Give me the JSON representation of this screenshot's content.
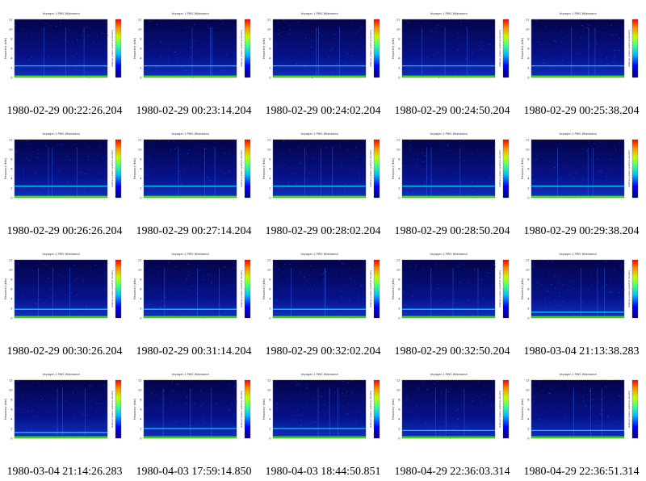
{
  "figure": {
    "panel_title": "Voyager-1 PWS Wideband",
    "ylabel": "Frequency (kHz)",
    "colorbar_label": "relative power spectral density",
    "yticks": [
      "0",
      "2",
      "4",
      "6",
      "8",
      "10",
      "12"
    ],
    "colors": {
      "background": "#00008b",
      "band": "#00c8ff",
      "low_band": "#39e600",
      "bright": "#ff3000"
    }
  },
  "captions": [
    "1980-02-29 00:22:26.204",
    "1980-02-29 00:23:14.204",
    "1980-02-29 00:24:02.204",
    "1980-02-29 00:24:50.204",
    "1980-02-29 00:25:38.204",
    "1980-02-29 00:26:26.204",
    "1980-02-29 00:27:14.204",
    "1980-02-29 00:28:02.204",
    "1980-02-29 00:28:50.204",
    "1980-02-29 00:29:38.204",
    "1980-02-29 00:30:26.204",
    "1980-02-29 00:31:14.204",
    "1980-02-29 00:32:02.204",
    "1980-02-29 00:32:50.204",
    "1980-03-04 21:13:38.283",
    "1980-03-04 21:14:26.283",
    "1980-04-03 17:59:14.850",
    "1980-04-03 18:44:50.851",
    "1980-04-29 22:36:03.314",
    "1980-04-29 22:36:51.314"
  ],
  "chart_data": {
    "type": "heatmap",
    "layout": "grid 4 rows x 5 columns of spectrogram panels",
    "ylabel": "Frequency (kHz)",
    "ylim": [
      0,
      12
    ],
    "colorbar": "relative power spectral density",
    "panels": [
      {
        "caption": "1980-02-29 00:22:26.204",
        "band_khz": 2.4,
        "low_band_khz": 0.4
      },
      {
        "caption": "1980-02-29 00:23:14.204",
        "band_khz": 2.4,
        "low_band_khz": 0.4
      },
      {
        "caption": "1980-02-29 00:24:02.204",
        "band_khz": 2.4,
        "low_band_khz": 0.4
      },
      {
        "caption": "1980-02-29 00:24:50.204",
        "band_khz": 2.4,
        "low_band_khz": 0.4
      },
      {
        "caption": "1980-02-29 00:25:38.204",
        "band_khz": 2.4,
        "low_band_khz": 0.4
      },
      {
        "caption": "1980-02-29 00:26:26.204",
        "band_khz": 2.4,
        "low_band_khz": 0.4
      },
      {
        "caption": "1980-02-29 00:27:14.204",
        "band_khz": 2.4,
        "low_band_khz": 0.4
      },
      {
        "caption": "1980-02-29 00:28:02.204",
        "band_khz": 2.4,
        "low_band_khz": 0.4
      },
      {
        "caption": "1980-02-29 00:28:50.204",
        "band_khz": 2.4,
        "low_band_khz": 0.4
      },
      {
        "caption": "1980-02-29 00:29:38.204",
        "band_khz": 2.4,
        "low_band_khz": 0.4
      },
      {
        "caption": "1980-02-29 00:30:26.204",
        "band_khz": 1.8,
        "low_band_khz": 0.4
      },
      {
        "caption": "1980-02-29 00:31:14.204",
        "band_khz": 1.8,
        "low_band_khz": 0.4
      },
      {
        "caption": "1980-02-29 00:32:02.204",
        "band_khz": 1.8,
        "low_band_khz": 0.4
      },
      {
        "caption": "1980-02-29 00:32:50.204",
        "band_khz": 1.8,
        "low_band_khz": 0.4
      },
      {
        "caption": "1980-03-04 21:13:38.283",
        "band_khz": 1.2,
        "low_band_khz": 0.4
      },
      {
        "caption": "1980-03-04 21:14:26.283",
        "band_khz": 1.2,
        "low_band_khz": 0.4
      },
      {
        "caption": "1980-04-03 17:59:14.850",
        "band_khz": 2.0,
        "low_band_khz": 0.4
      },
      {
        "caption": "1980-04-03 18:44:50.851",
        "band_khz": 2.0,
        "low_band_khz": 0.4
      },
      {
        "caption": "1980-04-29 22:36:03.314",
        "band_khz": 1.6,
        "low_band_khz": 0.4
      },
      {
        "caption": "1980-04-29 22:36:51.314",
        "band_khz": 1.6,
        "low_band_khz": 0.4
      }
    ]
  }
}
